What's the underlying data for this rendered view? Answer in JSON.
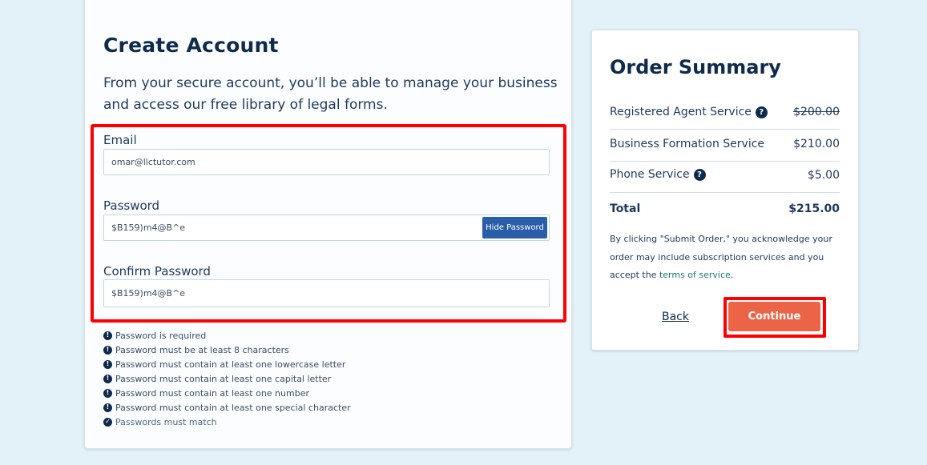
{
  "create_account": {
    "title": "Create Account",
    "intro": "From your secure account, you’ll be able to manage your business and access our free library of legal forms.",
    "email_label": "Email",
    "email_value": "omar@llctutor.com",
    "password_label": "Password",
    "password_value": "$B159)m4@B^e",
    "hide_password_label": "Hide Password",
    "confirm_label": "Confirm Password",
    "confirm_value": "$B159)m4@B^e",
    "rules": [
      {
        "text": "Password is required",
        "status": "error"
      },
      {
        "text": "Password must be at least 8 characters",
        "status": "error"
      },
      {
        "text": "Password must contain at least one lowercase letter",
        "status": "error"
      },
      {
        "text": "Password must contain at least one capital letter",
        "status": "error"
      },
      {
        "text": "Password must contain at least one number",
        "status": "error"
      },
      {
        "text": "Password must contain at least one special character",
        "status": "error"
      },
      {
        "text": "Passwords must match",
        "status": "ok"
      }
    ]
  },
  "order_summary": {
    "title": "Order Summary",
    "items": [
      {
        "label": "Registered Agent Service",
        "amount": "$200.00",
        "info_icon": "question-icon"
      },
      {
        "label": "Business Formation Service",
        "amount": "$210.00"
      },
      {
        "label": "Phone Service",
        "amount": "$5.00",
        "info_icon": "question-icon"
      }
    ],
    "total_label": "Total",
    "total_amount": "$215.00",
    "disclaimer_text": "By clicking \"Submit Order,\" you acknowledge your order may include subscription services and you accept the",
    "terms_link": "terms of service",
    "disclaimer_end": ".",
    "back_label": "Back",
    "continue_label": "Continue"
  },
  "colors": {
    "navy": "#0f2b4c",
    "accent_blue": "#2a5ea8",
    "continue_orange": "#ec6448",
    "highlight_red": "#ff0000",
    "terms_green": "#1a7a6a",
    "page_bg": "#e3f1f8"
  },
  "icons": {
    "rule_error": "exclamation-circle-icon",
    "rule_ok": "check-circle-icon",
    "info": "question-circle-icon"
  }
}
